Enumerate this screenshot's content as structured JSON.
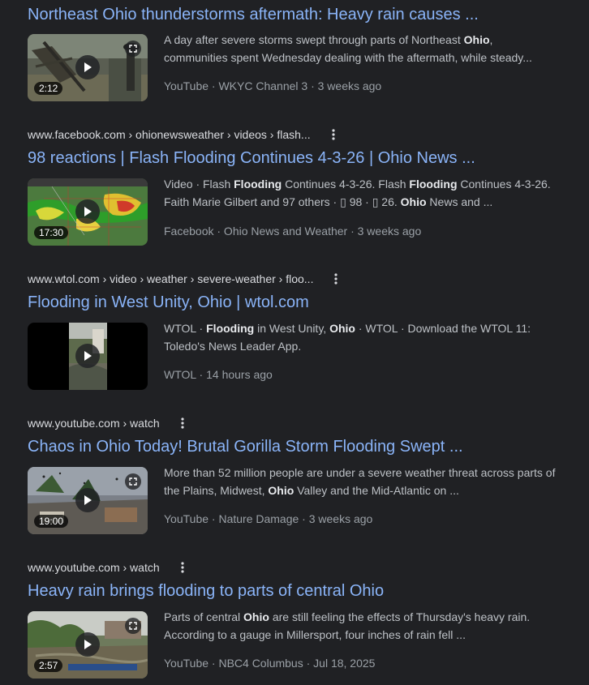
{
  "results": [
    {
      "title": "Northeast Ohio thunderstorms aftermath: Heavy rain causes ...",
      "duration": "2:12",
      "snippet": {
        "line1": [
          "A day after severe storms swept through parts of Northeast ",
          "Ohio",
          ","
        ],
        "line2": "communities spent Wednesday dealing with the aftermath, while steady..."
      },
      "meta": "YouTube · WKYC Channel 3 · 3 weeks ago"
    },
    {
      "url": "www.facebook.com › ohionewsweather › videos › flash...",
      "title": "98 reactions | Flash Flooding Continues 4-3-26 | Ohio News ...",
      "duration": "17:30",
      "snippet": {
        "line1": [
          "Video · Flash ",
          "Flooding",
          " Continues 4-3-26. Flash ",
          "Flooding",
          " Continues 4-3-26."
        ],
        "line2": [
          "Faith Marie Gilbert and 97 others · ▯ 98 · ▯ 26. ",
          "Ohio",
          " News and ..."
        ]
      },
      "meta": "Facebook · Ohio News and Weather · 3 weeks ago"
    },
    {
      "url": "www.wtol.com › video › weather › severe-weather › floo...",
      "title": "Flooding in West Unity, Ohio | wtol.com",
      "snippet": {
        "line1": [
          "WTOL · ",
          "Flooding",
          " in West Unity, ",
          "Ohio",
          " · WTOL · Download the WTOL 11:"
        ],
        "line2": "Toledo's News Leader App."
      },
      "meta": "WTOL · 14 hours ago"
    },
    {
      "url": "www.youtube.com › watch",
      "title": "Chaos in Ohio Today! Brutal Gorilla Storm Flooding Swept ...",
      "duration": "19:00",
      "snippet": {
        "line1": "More than 52 million people are under a severe weather threat across parts of",
        "line2": [
          "the Plains, Midwest, ",
          "Ohio",
          " Valley and the Mid-Atlantic on ..."
        ]
      },
      "meta": "YouTube · Nature Damage · 3 weeks ago"
    },
    {
      "url": "www.youtube.com › watch",
      "title": "Heavy rain brings flooding to parts of central Ohio",
      "duration": "2:57",
      "snippet": {
        "line1": [
          "Parts of central ",
          "Ohio",
          " are still feeling the effects of Thursday's heavy rain."
        ],
        "line2": "According to a gauge in Millersport, four inches of rain fell ..."
      },
      "meta": "YouTube · NBC4 Columbus · Jul 18, 2025"
    }
  ],
  "colors": {
    "background": "#202124",
    "title_link": "#8ab4f8",
    "url_text": "#dadce0",
    "snippet_text": "#bdc1c6",
    "meta_text": "#9aa0a6"
  },
  "icons": [
    "play-icon",
    "expand-icon",
    "more-vert-icon"
  ]
}
